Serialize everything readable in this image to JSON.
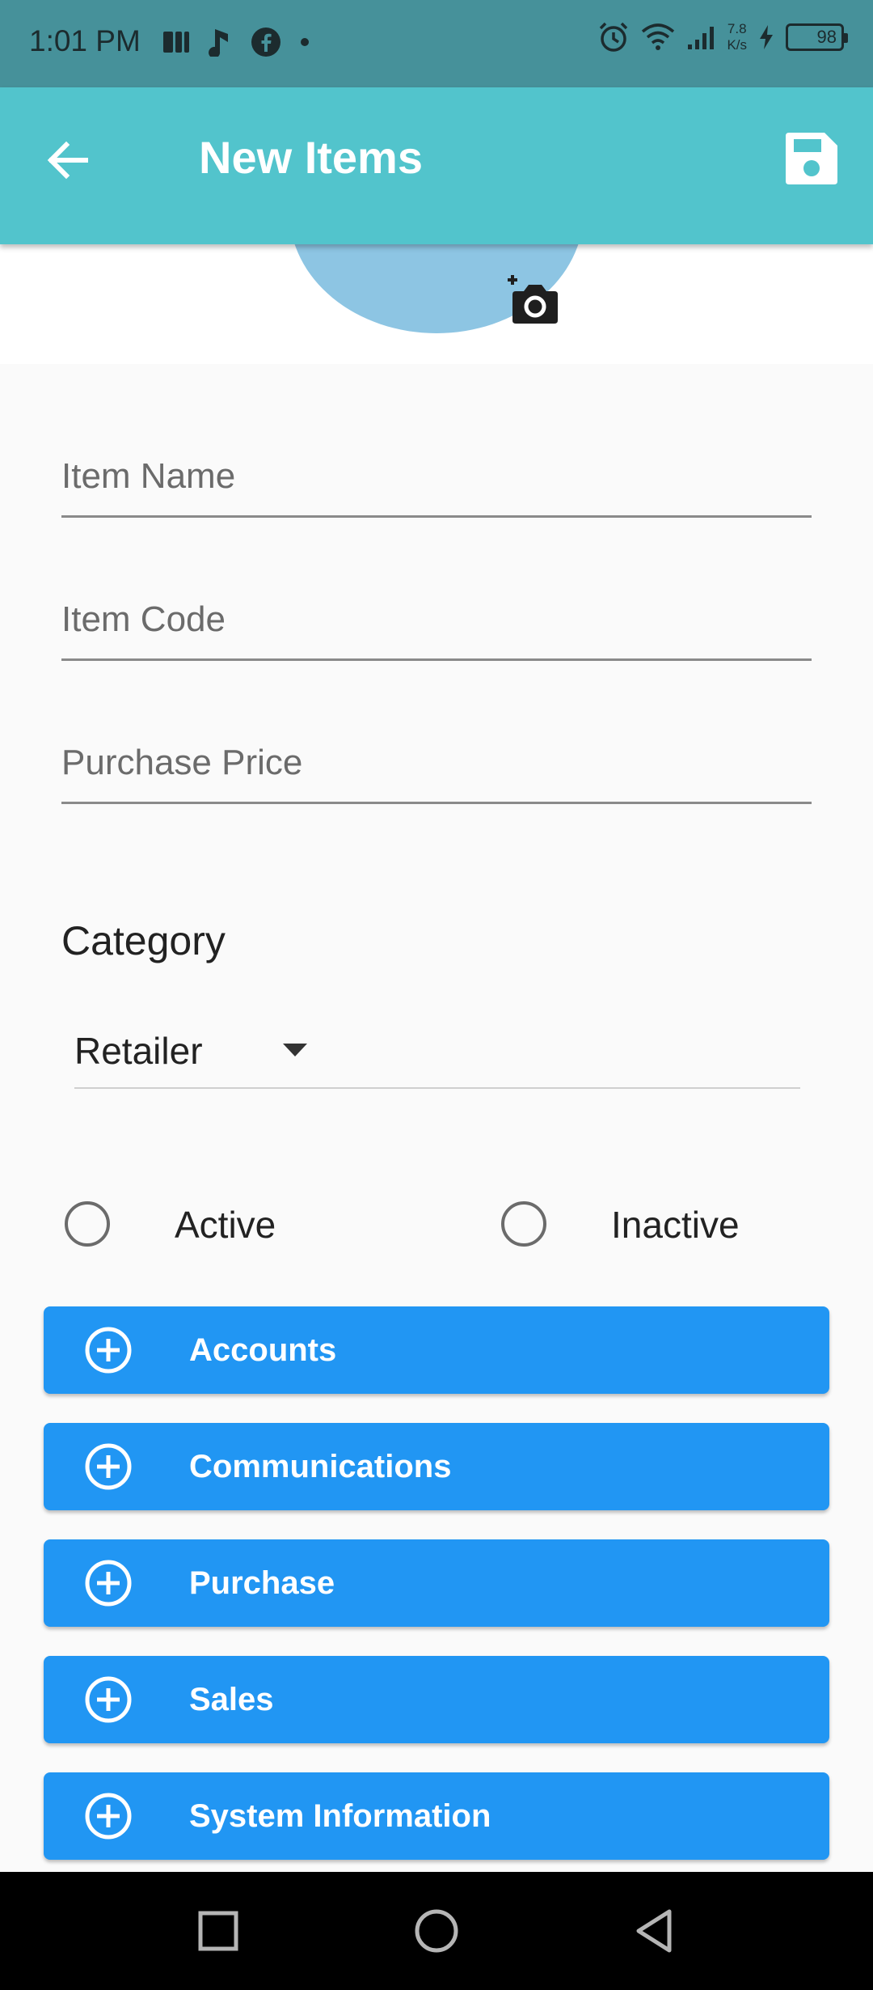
{
  "status_bar": {
    "time": "1:01 PM",
    "net_speed_value": "7.8",
    "net_speed_unit": "K/s",
    "battery": "98"
  },
  "app_bar": {
    "title": "New Items",
    "back_icon": "arrow-back-icon",
    "save_icon": "save-icon"
  },
  "photo": {
    "camera_icon": "add-photo-camera-icon"
  },
  "form": {
    "item_name_placeholder": "Item Name",
    "item_code_placeholder": "Item Code",
    "purchase_price_placeholder": "Purchase Price",
    "category_label": "Category",
    "category_value": "Retailer",
    "status_options": [
      "Active",
      "Inactive"
    ]
  },
  "sections": [
    {
      "label": "Accounts"
    },
    {
      "label": "Communications"
    },
    {
      "label": "Purchase"
    },
    {
      "label": "Sales"
    },
    {
      "label": "System Information"
    }
  ],
  "colors": {
    "status_bar": "#46919a",
    "app_bar": "#52c4cc",
    "section_button": "#2196f3",
    "avatar": "#8dc5e3"
  }
}
